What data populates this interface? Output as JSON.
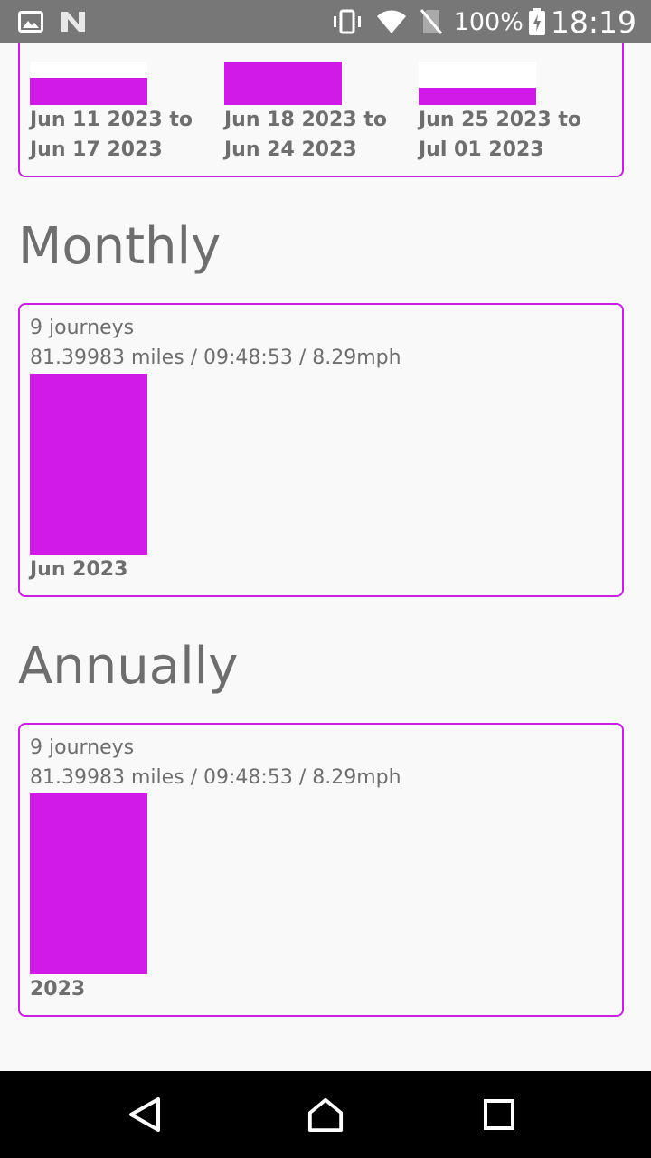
{
  "status_bar": {
    "icons_left": [
      "image-icon",
      "n-icon"
    ],
    "icons_right": [
      "vibrate-icon",
      "wifi-icon",
      "no-sim-icon",
      "battery-charging-icon"
    ],
    "battery": "100%",
    "time": "18:19"
  },
  "weekly": {
    "weeks": [
      {
        "label": "Jun 11 2023 to Jun 17 2023",
        "fill": 0.625
      },
      {
        "label": "Jun 18 2023 to Jun 24 2023",
        "fill": 1.0
      },
      {
        "label": "Jun 25 2023 to Jul 01 2023",
        "fill": 0.4
      }
    ]
  },
  "monthly": {
    "heading": "Monthly",
    "journeys": "9 journeys",
    "stats": "81.39983 miles / 09:48:53 / 8.29mph",
    "bars": [
      {
        "label": "Jun 2023",
        "fill": 1.0
      }
    ]
  },
  "annually": {
    "heading": "Annually",
    "journeys": "9 journeys",
    "stats": "81.39983 miles / 09:48:53 / 8.29mph",
    "bars": [
      {
        "label": "2023",
        "fill": 1.0
      }
    ]
  },
  "nav_bar": {
    "buttons": [
      "back-icon",
      "home-icon",
      "recents-icon"
    ]
  },
  "colors": {
    "accent": "#d11ae8",
    "border": "#c81fe0",
    "text": "#6e6e6e",
    "status_bar": "#777777"
  }
}
